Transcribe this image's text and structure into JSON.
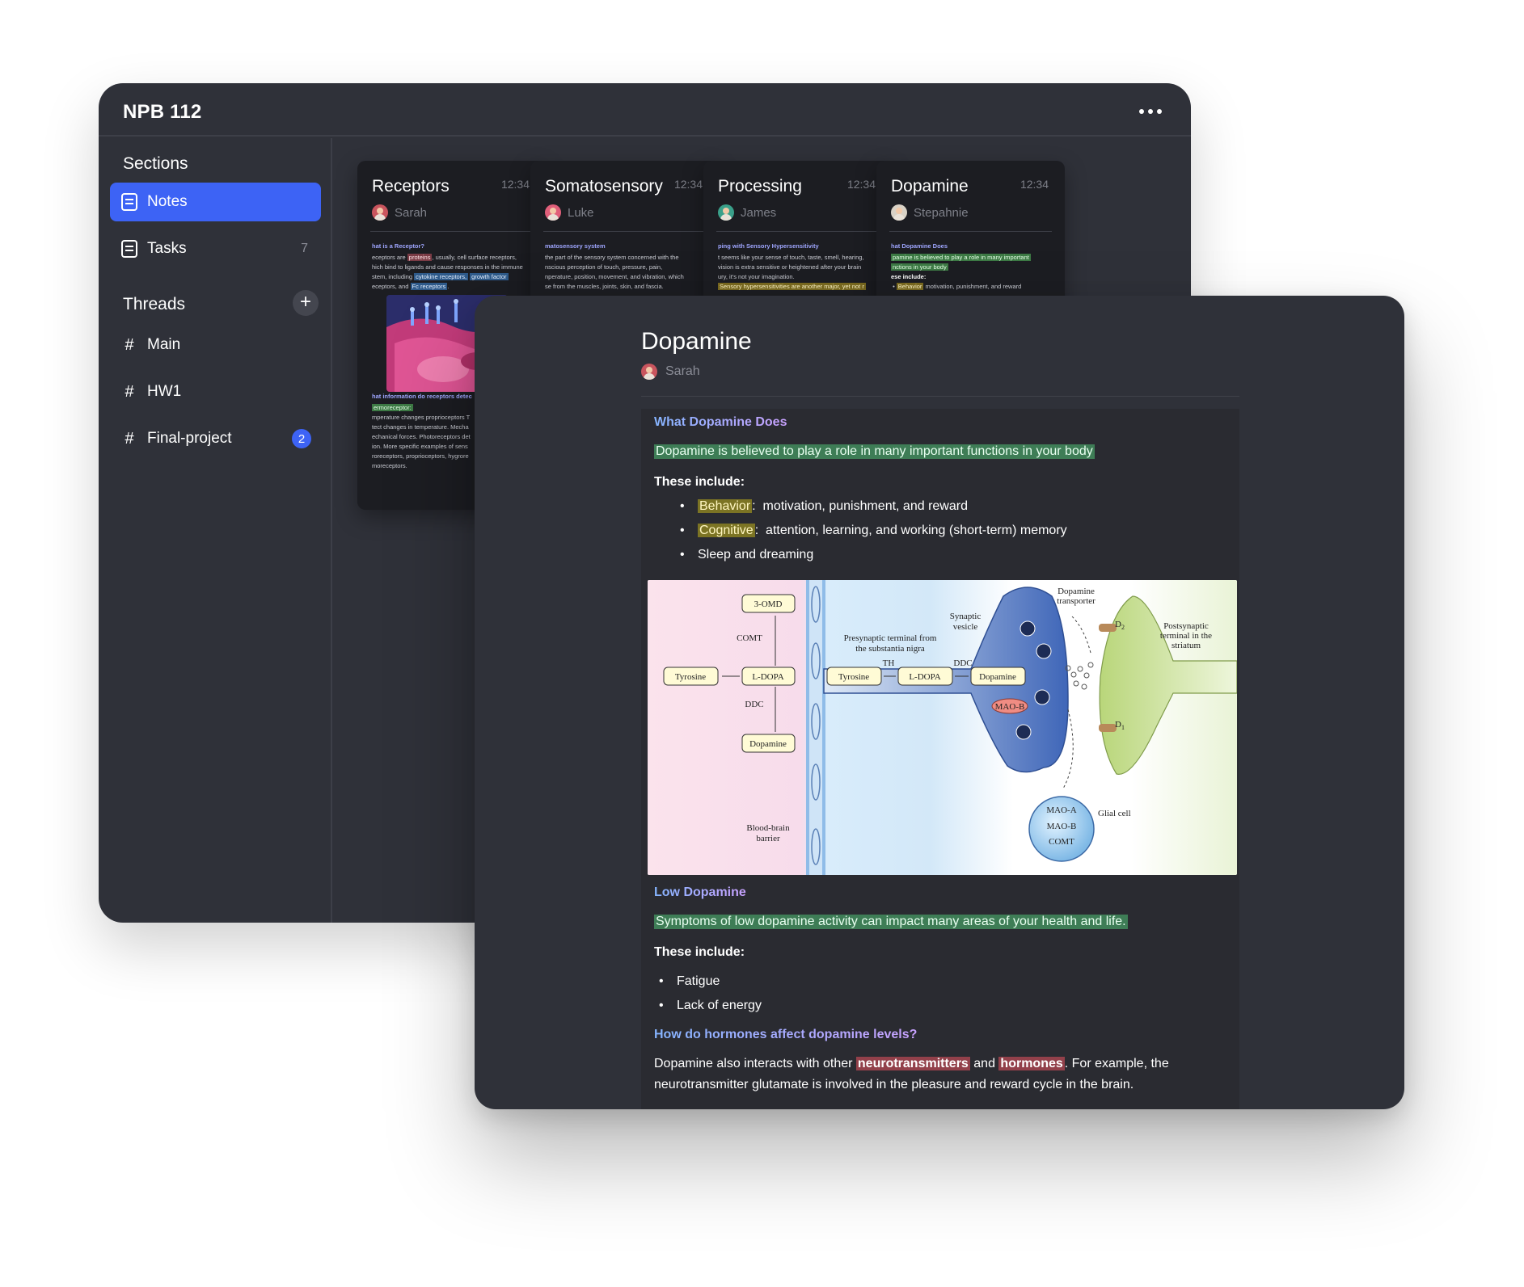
{
  "app": {
    "title": "NPB 112"
  },
  "sidebar": {
    "sections_heading": "Sections",
    "sections": [
      {
        "label": "Notes",
        "count": "",
        "icon": "notes-icon",
        "active": true
      },
      {
        "label": "Tasks",
        "count": "7",
        "icon": "tasks-icon",
        "active": false
      }
    ],
    "threads_heading": "Threads",
    "threads": [
      {
        "label": "Main",
        "badge": ""
      },
      {
        "label": "HW1",
        "badge": ""
      },
      {
        "label": "Final-project",
        "badge": "2"
      }
    ]
  },
  "cards": [
    {
      "title": "Receptors",
      "time": "12:34",
      "author": "Sarah"
    },
    {
      "title": "Somatosensory",
      "time": "12:34",
      "author": "Luke"
    },
    {
      "title": "Processing",
      "time": "12:34",
      "author": "James"
    },
    {
      "title": "Dopamine",
      "time": "12:34",
      "author": "Stepahnie"
    }
  ],
  "card_previews": {
    "receptors": {
      "head1": "hat is a Receptor?",
      "l1a": "eceptors are ",
      "l1b": "proteins",
      "l1c": ", usually, cell surface receptors,",
      "l2": "hich bind to ligands and cause responses in the immune",
      "l3a": "stem, including ",
      "l3b": "cytokine receptors,",
      "l3c": "growth factor",
      "l4a": "eceptors, and ",
      "l4b": "Fc receptors",
      "head2": "hat information do receptors detec",
      "term": "ermoreceptor:",
      "b1": "mperature changes proprioceptors T",
      "b2": "tect changes in temperature. Mecha",
      "b3": "echanical forces. Photoreceptors det",
      "b4": "ion. More specific examples of sens",
      "b5": "roreceptors, proprioceptors, hygrore",
      "b6": "moreceptors."
    },
    "somatosensory": {
      "head": "matosensory system",
      "l1": "the part of the sensory system concerned with the",
      "l2": "nscious perception of touch, pressure, pain,",
      "l3": "nperature, position, movement, and vibration, which",
      "l4": "se from the muscles, joints, skin, and fascia."
    },
    "processing": {
      "head": "ping with Sensory Hypersensitivity",
      "l1": "t seems like your sense of touch, taste, smell, hearing,",
      "l2": "vision is extra sensitive or heightened after your brain",
      "l3": "ury, it's not your imagination.",
      "l4": "Sensory hypersensitivities are another major, yet not r"
    },
    "dopamine": {
      "head": "hat Dopamine Does",
      "l1": "pamine is believed to play a role in many important",
      "l2": "nctions in your body",
      "l3": "ese include:",
      "tag": "Behavior",
      "l4": "motivation, punishment, and reward"
    }
  },
  "note": {
    "title": "Dopamine",
    "author": "Sarah",
    "section1_heading": "What Dopamine Does",
    "section1_highlight": "Dopamine is believed to play a role in many important functions in your body",
    "section1_include": "These include:",
    "bullets1": [
      {
        "tag": "Behavior",
        "text": "motivation, punishment, and reward"
      },
      {
        "tag": "Cognitive",
        "text": "attention, learning, and working (short-term) memory"
      },
      {
        "tag": "",
        "text": "Sleep and dreaming"
      }
    ],
    "section2_heading": "Low Dopamine",
    "section2_highlight": "Symptoms of low dopamine activity can impact many areas of your health and life.",
    "section2_include": "These include:",
    "bullets2": [
      "Fatigue",
      "Lack of energy"
    ],
    "section3_heading": "How do hormones affect dopamine levels?",
    "para_a": "Dopamine also interacts with other ",
    "para_b": "neurotransmitters",
    "para_c": " and ",
    "para_d": "hormones",
    "para_e": ". For example, the",
    "para_f": "neurotransmitter glutamate is involved in the pleasure and reward cycle in the brain."
  },
  "diagram": {
    "box_3omd": "3-OMD",
    "comt": "COMT",
    "tyrosine": "Tyrosine",
    "ldopa": "L-DOPA",
    "ddc": "DDC",
    "dopamine": "Dopamine",
    "bbb_1": "Blood-brain",
    "bbb_2": "barrier",
    "presyn_1": "Presynaptic terminal from",
    "presyn_2": "the substantia nigra",
    "th": "TH",
    "ddc2": "DDC",
    "tyrosine2": "Tyrosine",
    "ldopa2": "L-DOPA",
    "dopamine2": "Dopamine",
    "maob": "MAO-B",
    "synaptic_1": "Synaptic",
    "synaptic_2": "vesicle",
    "transporter_1": "Dopamine",
    "transporter_2": "transporter",
    "d2": "D",
    "d2_sub": "2",
    "d1": "D",
    "d1_sub": "1",
    "post_1": "Postsynaptic",
    "post_2": "terminal in the",
    "post_3": "striatum",
    "glial": "Glial cell",
    "maoa_g": "MAO-A",
    "maob_g": "MAO-B",
    "comt_g": "COMT"
  }
}
